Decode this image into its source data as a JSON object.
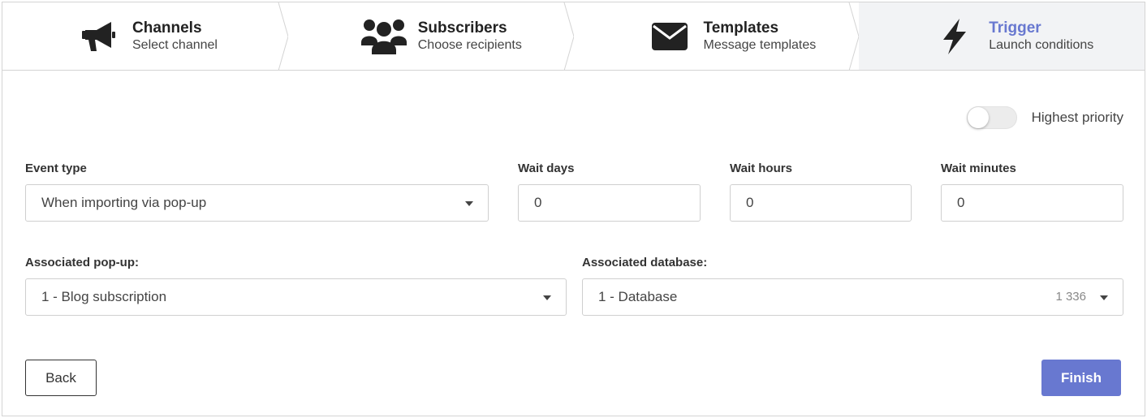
{
  "steps": [
    {
      "title": "Channels",
      "subtitle": "Select channel",
      "icon": "megaphone-icon"
    },
    {
      "title": "Subscribers",
      "subtitle": "Choose recipients",
      "icon": "users-icon"
    },
    {
      "title": "Templates",
      "subtitle": "Message templates",
      "icon": "envelope-icon"
    },
    {
      "title": "Trigger",
      "subtitle": "Launch conditions",
      "icon": "bolt-icon",
      "active": true
    }
  ],
  "priority": {
    "label": "Highest priority",
    "enabled": false
  },
  "event_type": {
    "label": "Event type",
    "value": "When importing via pop-up"
  },
  "wait_days": {
    "label": "Wait days",
    "value": "0"
  },
  "wait_hours": {
    "label": "Wait hours",
    "value": "0"
  },
  "wait_minutes": {
    "label": "Wait minutes",
    "value": "0"
  },
  "popup": {
    "label": "Associated pop-up:",
    "value": "1 - Blog subscription"
  },
  "database": {
    "label": "Associated database:",
    "value": "1 - Database",
    "count": "1 336"
  },
  "buttons": {
    "back": "Back",
    "finish": "Finish"
  },
  "colors": {
    "accent": "#6878d0",
    "active_step_bg": "#f2f3f5",
    "border": "#d4d4d4"
  }
}
